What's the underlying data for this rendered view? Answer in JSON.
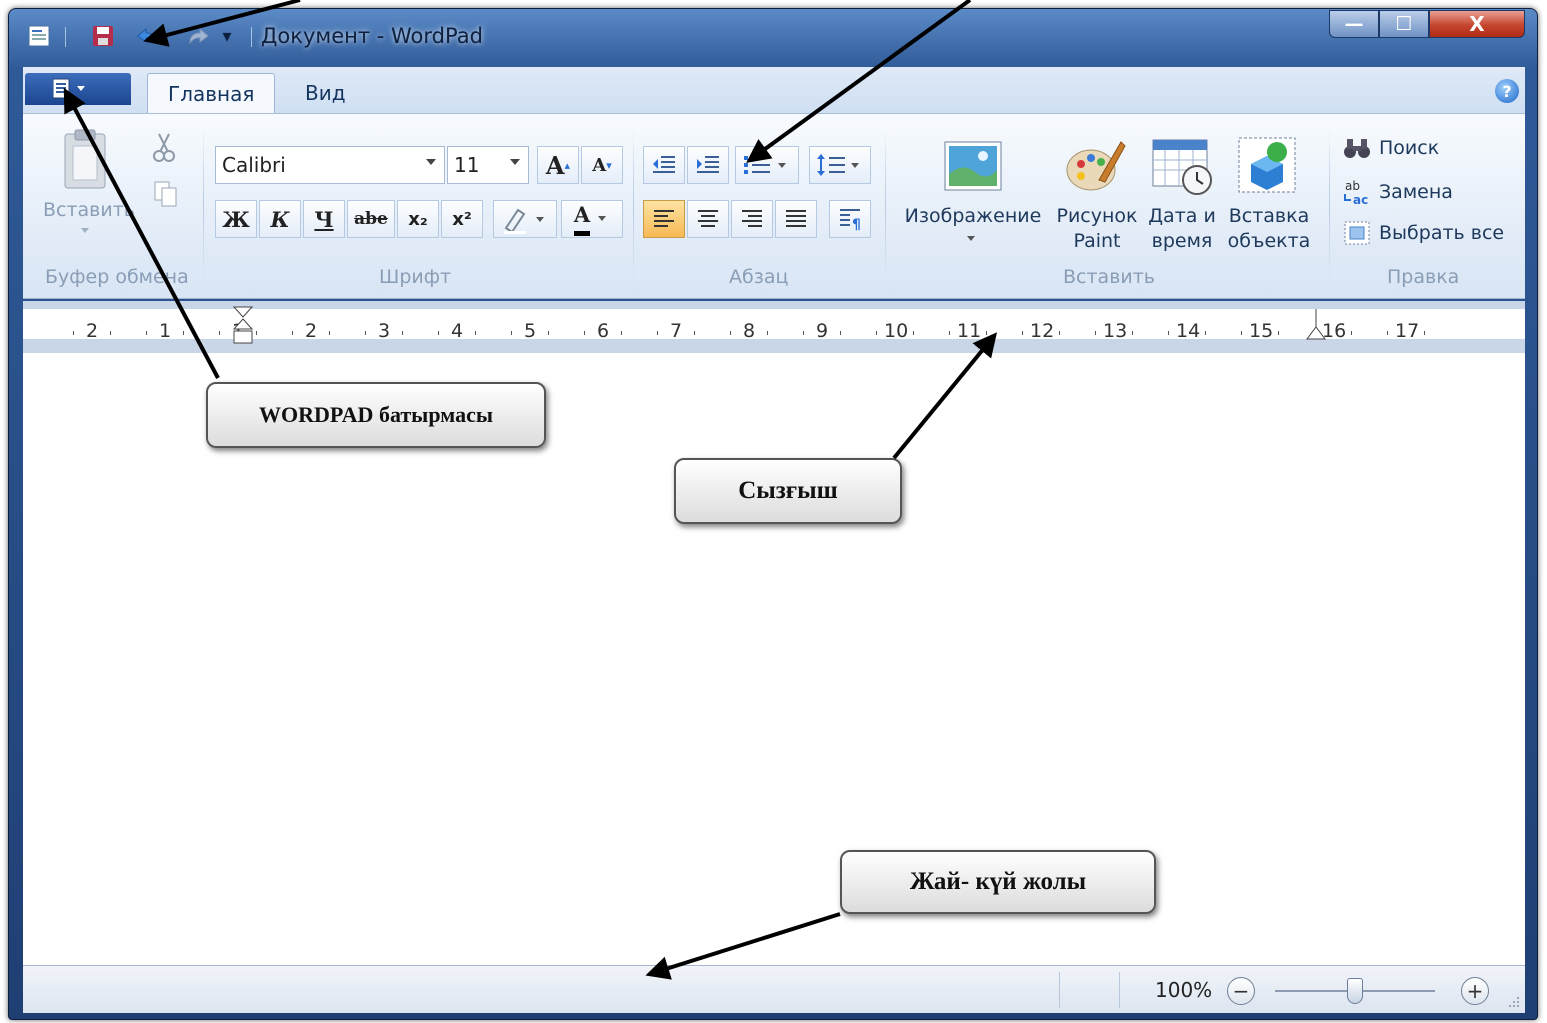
{
  "titlebar": {
    "title": "Документ - WordPad",
    "qat_dropdown": "▾",
    "minimize": "—",
    "maximize": "☐",
    "close": "X"
  },
  "ribbon": {
    "tabs": [
      {
        "label": "Главная",
        "active": true
      },
      {
        "label": "Вид",
        "active": false
      }
    ],
    "help": "?",
    "clipboard": {
      "group_label": "Буфер обмена",
      "paste_label": "Вставить"
    },
    "font": {
      "group_label": "Шрифт",
      "family": "Calibri",
      "size": "11",
      "grow": "A",
      "shrink": "A",
      "bold": "Ж",
      "italic": "К",
      "underline": "Ч",
      "strike": "abe",
      "subscript": "x₂",
      "superscript": "x²",
      "color_letter": "A"
    },
    "paragraph": {
      "group_label": "Абзац"
    },
    "insert": {
      "group_label": "Вставить",
      "picture": "Изображение",
      "paint_line1": "Рисунок",
      "paint_line2": "Paint",
      "datetime_line1": "Дата и",
      "datetime_line2": "время",
      "object_line1": "Вставка",
      "object_line2": "объекта"
    },
    "editing": {
      "group_label": "Правка",
      "find": "Поиск",
      "replace": "Замена",
      "select_all": "Выбрать все",
      "replace_icon_top": "ab",
      "replace_icon_bottom": "ac"
    }
  },
  "ruler": {
    "labels": [
      "2",
      "1",
      "1",
      "2",
      "3",
      "4",
      "5",
      "6",
      "7",
      "8",
      "9",
      "10",
      "11",
      "12",
      "13",
      "14",
      "15",
      "16",
      "17"
    ]
  },
  "statusbar": {
    "zoom": "100%",
    "zoom_out": "−",
    "zoom_in": "+",
    "zoom_level": 0.5
  },
  "annotations": {
    "wordpad_button": "WORDPAD батырмасы",
    "ruler": "Сызғыш",
    "status_bar": "Жай- күй жолы"
  },
  "colors": {
    "accent": "#f7b955",
    "title_bar": "#2f5a98",
    "ribbon": "#e1ebf7"
  }
}
